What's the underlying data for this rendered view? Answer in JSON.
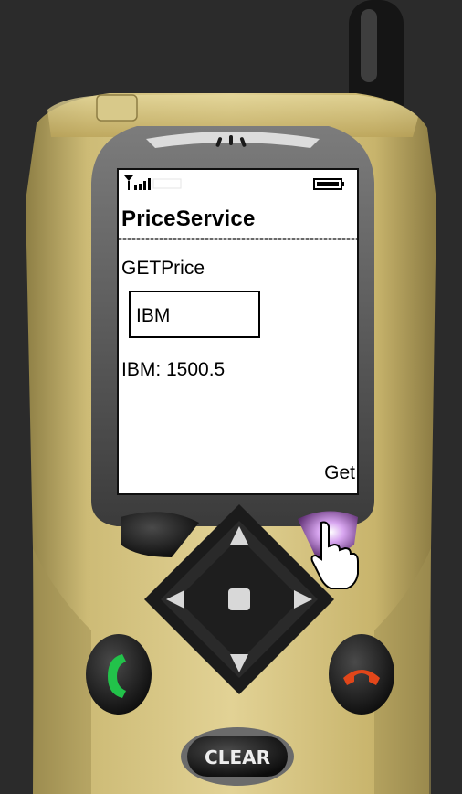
{
  "screen": {
    "app_title": "PriceService",
    "label": "GETPrice",
    "input_value": "IBM",
    "result_text": "IBM: 1500.5",
    "softkey_right_label": "Get"
  },
  "keys": {
    "clear_label": "CLEAR"
  },
  "colors": {
    "body_gold": "#c9b46a",
    "screen_bg": "#ffffff",
    "call_green": "#22c24a",
    "end_red": "#e1461a"
  }
}
